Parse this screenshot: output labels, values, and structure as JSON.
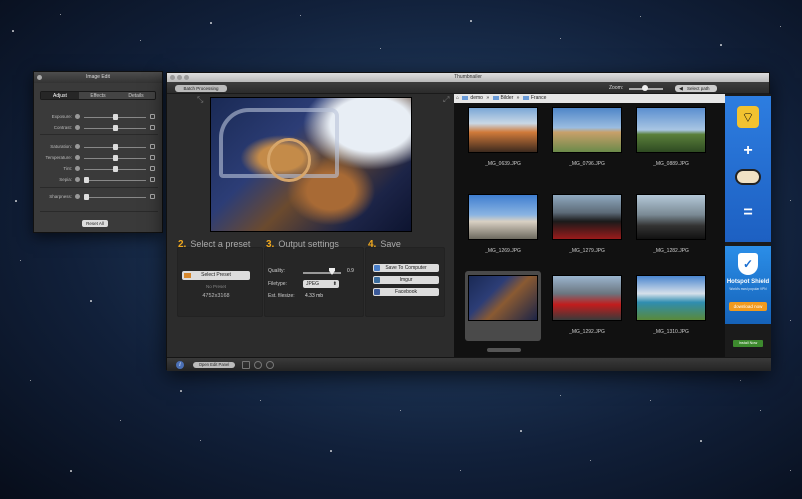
{
  "image_edit": {
    "title": "Image Edit",
    "tabs": [
      "Adjust",
      "Effects",
      "Details"
    ],
    "sliders": [
      {
        "label": "Exposure:",
        "value": 0.5,
        "left_icon": "dark-circle-icon",
        "right_icon": "sun-icon"
      },
      {
        "label": "Contrast:",
        "value": 0.5,
        "left_icon": "circle-icon",
        "right_icon": "half-circle-icon"
      },
      {
        "label": "Saturation:",
        "value": 0.5,
        "left_icon": "gray-square-icon",
        "right_icon": "color-square-icon"
      },
      {
        "label": "Temperature:",
        "value": 0.5,
        "left_icon": "cool-icon",
        "right_icon": "warm-icon"
      },
      {
        "label": "Tint:",
        "value": 0.5,
        "left_icon": "green-dot-icon",
        "right_icon": "magenta-dot-icon"
      },
      {
        "label": "Sepia:",
        "value": 0.0,
        "left_icon": "gray-dot-icon",
        "right_icon": "sepia-square-icon"
      },
      {
        "label": "Sharpness:",
        "value": 0.0,
        "left_icon": "blur-icon",
        "right_icon": "sharp-icon"
      }
    ],
    "reset_label": "Reset All"
  },
  "window": {
    "title": "Thumbnailer",
    "batch_label": "Batch Processing",
    "zoom_label": "Zoom:",
    "zoom_value": 0.45,
    "select_path_label": "Select path"
  },
  "preset": {
    "number": "2.",
    "title": "Select a preset",
    "button_label": "Select Preset",
    "current": "No Preset",
    "dimensions": "4752x3168"
  },
  "output": {
    "number": "3.",
    "title": "Output settings",
    "quality_label": "Quality:",
    "quality_value": "0.9",
    "filetype_label": "Filetype:",
    "filetype_value": "JPEG",
    "filesize_label": "Est. filesize:",
    "filesize_value": "4.33 mb"
  },
  "save": {
    "number": "4.",
    "title": "Save",
    "buttons": [
      {
        "label": "Save To Computer",
        "icon": "computer-icon",
        "color": "#4a7fc9"
      },
      {
        "label": "Imgur",
        "icon": "imgur-icon",
        "color": "#3b6d9e"
      },
      {
        "label": "Facebook",
        "icon": "facebook-icon",
        "color": "#3b5998"
      }
    ]
  },
  "bottom": {
    "info_icon": "info-icon",
    "open_edit_label": "Open Edit Panel"
  },
  "browser": {
    "breadcrumb": [
      "demo",
      "Bilder",
      "France"
    ],
    "files": [
      "_MG_0639.JPG",
      "_MG_0796.JPG",
      "_MG_0889.JPG",
      "_MG_1269.JPG",
      "_MG_1279.JPG",
      "_MG_1282.JPG",
      "",
      "_MG_1292.JPG",
      "_MG_1310.JPG"
    ]
  },
  "ad": {
    "title": "Hotspot Shield",
    "subtitle": "World's most popular VPN",
    "download_label": "download now",
    "link_label": "Install Now"
  }
}
